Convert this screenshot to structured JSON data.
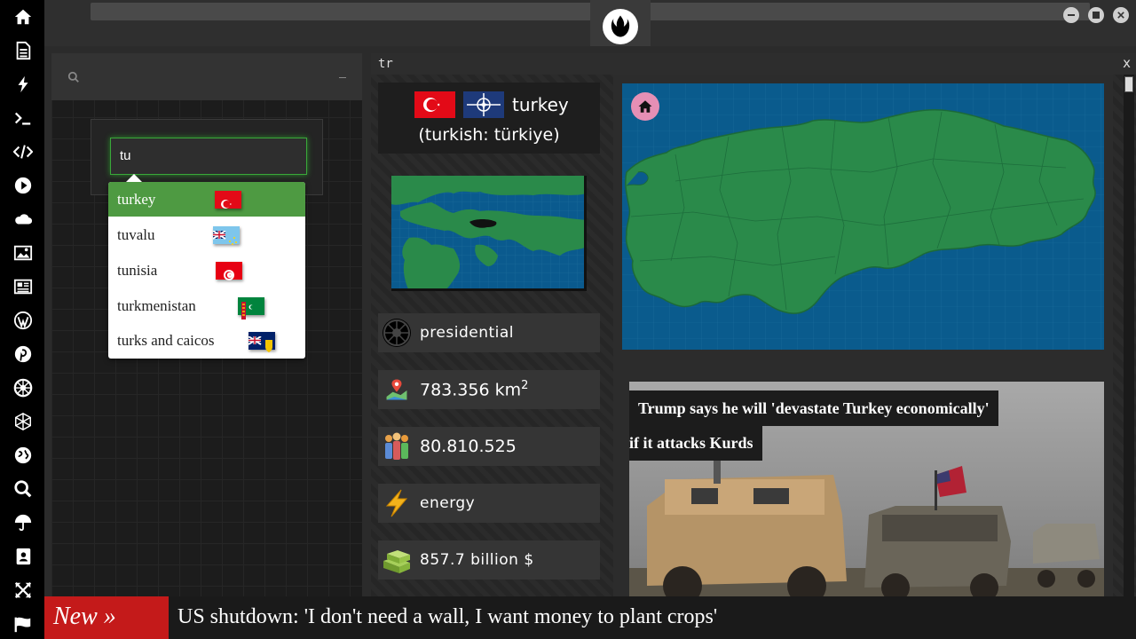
{
  "sidebar": {
    "icons": [
      "home-icon",
      "document-icon",
      "lightning-icon",
      "terminal-icon",
      "code-icon",
      "play-icon",
      "cloud-icon",
      "image-icon",
      "newspaper-icon",
      "wordpress-icon",
      "pinterest-icon",
      "empire-icon",
      "globe-wire-icon",
      "world-icon",
      "search-icon",
      "umbrella-icon",
      "contacts-icon",
      "expand-icon",
      "flag-icon"
    ]
  },
  "search": {
    "value": "tu",
    "suggestions": [
      {
        "label": "turkey",
        "flag": "turkey-flag",
        "selected": true
      },
      {
        "label": "tuvalu",
        "flag": "tuvalu-flag",
        "selected": false
      },
      {
        "label": "tunisia",
        "flag": "tunisia-flag",
        "selected": false
      },
      {
        "label": "turkmenistan",
        "flag": "turkmenistan-flag",
        "selected": false
      },
      {
        "label": "turks and caicos",
        "flag": "turks-caicos-flag",
        "selected": false
      }
    ]
  },
  "panel": {
    "code": "tr",
    "close": "x"
  },
  "country": {
    "name": "turkey",
    "native": "(turkish: türkiye)",
    "government": "presidential",
    "area": "783.356 km",
    "area_sup": "2",
    "population": "80.810.525",
    "resource": "energy",
    "gdp": "857.7 billion $"
  },
  "news": {
    "headline_line1": "Trump says he will 'devastate Turkey economically'",
    "headline_line2": "if it attacks Kurds"
  },
  "ticker": {
    "label": "New »",
    "message": "US shutdown: 'I don't need a wall, I want money to plant crops'"
  },
  "colors": {
    "accent_green": "#4e9a42",
    "ticker_red": "#c41a1a",
    "map_sea": "#0a5b8d",
    "map_land": "#2a8a4a"
  }
}
